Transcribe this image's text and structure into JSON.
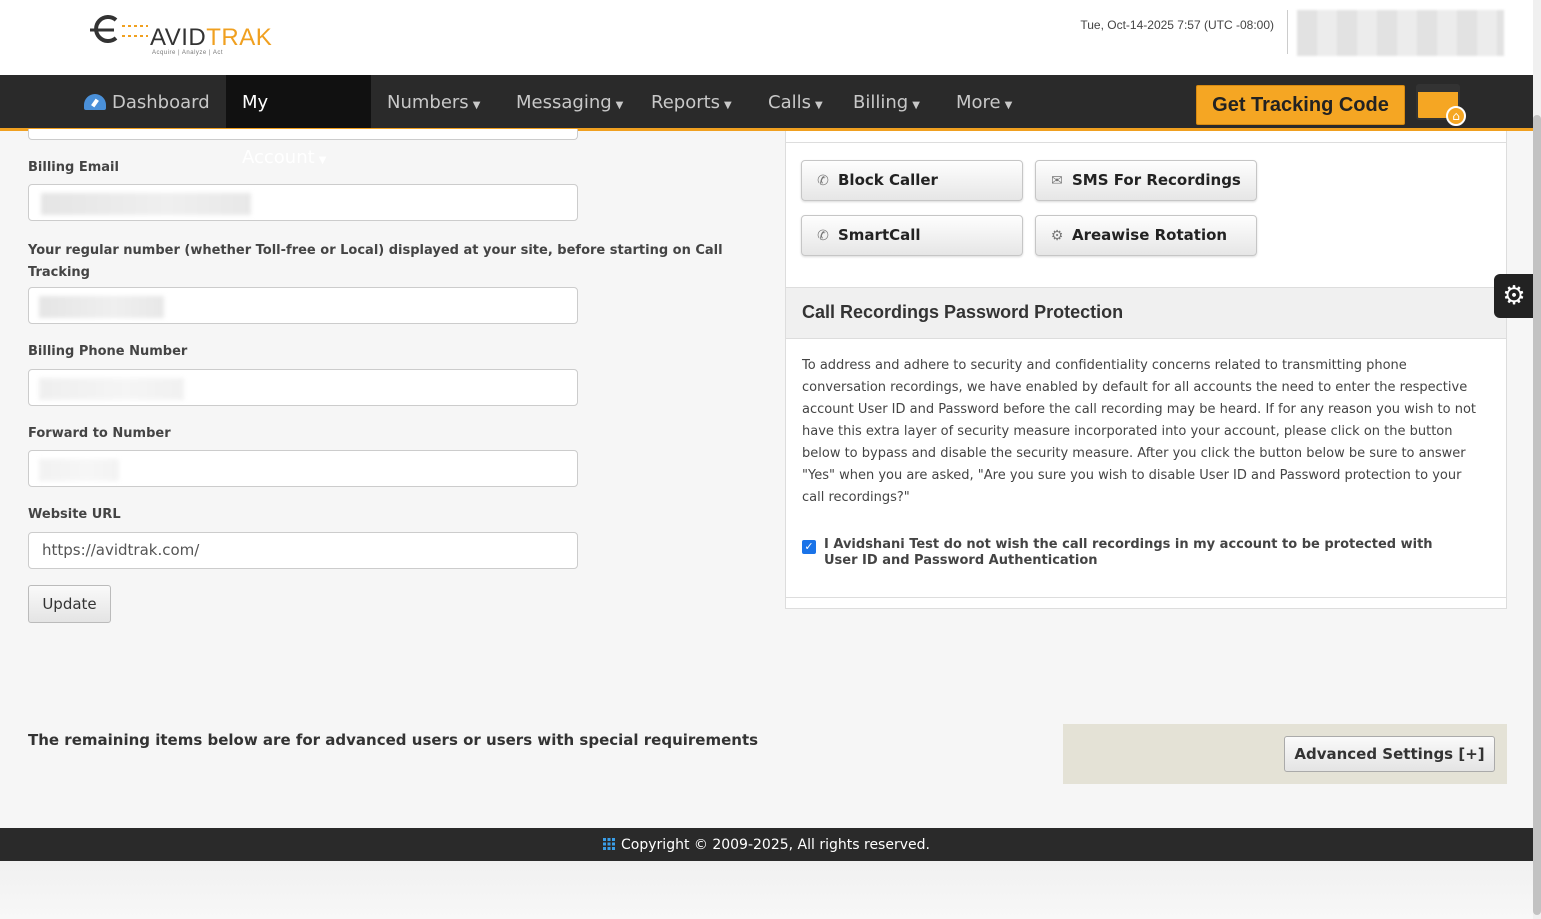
{
  "header": {
    "logo_text_a": "A",
    "logo_text_b": "VID",
    "logo_text_c": "TRAK",
    "logo_tagline": "Acquire  |  Analyze  |  Act",
    "datetime": "Tue, Oct-14-2025 7:57 (UTC -08:00)"
  },
  "nav": {
    "dashboard": "Dashboard",
    "my_account": "My Account",
    "numbers": "Numbers",
    "messaging": "Messaging",
    "reports": "Reports",
    "calls": "Calls",
    "billing": "Billing",
    "more": "More",
    "tracking_button": "Get Tracking Code"
  },
  "form": {
    "billing_email_label": "Billing Email",
    "regular_number_label": "Your regular number (whether Toll-free or Local) displayed at your site, before starting on Call Tracking",
    "billing_phone_label": "Billing Phone Number",
    "forward_label": "Forward to Number",
    "website_label": "Website URL",
    "website_value": "https://avidtrak.com/",
    "update_button": "Update"
  },
  "tools": {
    "block_caller": "Block Caller",
    "sms_recordings": "SMS For Recordings",
    "smartcall": "SmartCall",
    "areawise_rotation": "Areawise Rotation"
  },
  "recordings": {
    "title": "Call Recordings Password Protection",
    "body": "To address and adhere to security and confidentiality concerns related to transmitting phone conversation recordings, we have enabled by default for all accounts the need to enter the respective account User ID and Password before the call recording may be heard. If for any reason you wish to not have this extra layer of security measure incorporated into your account, please click on the button below to bypass and disable the security measure. After you click the button below be sure to answer \"Yes\" when you are asked, \"Are you sure you wish to disable User ID and Password protection to your call recordings?\"",
    "checkbox_label": "I Avidshani Test do not wish the call recordings in my account to be protected with User ID and Password Authentication",
    "checkbox_checked": true
  },
  "advanced": {
    "note": "The remaining items below are for advanced users or users with special requirements",
    "button": "Advanced Settings [+]"
  },
  "footer": {
    "copyright": "Copyright © 2009-2025, All rights reserved."
  },
  "icons": {
    "dashboard": "dashboard-gauge-icon",
    "gear": "gear-icon",
    "tracking": "code-window-icon",
    "footer": "grid-icon"
  },
  "colors": {
    "accent": "#f0a020",
    "nav_bg": "#2a2a2a",
    "checkbox": "#1a73e8"
  }
}
